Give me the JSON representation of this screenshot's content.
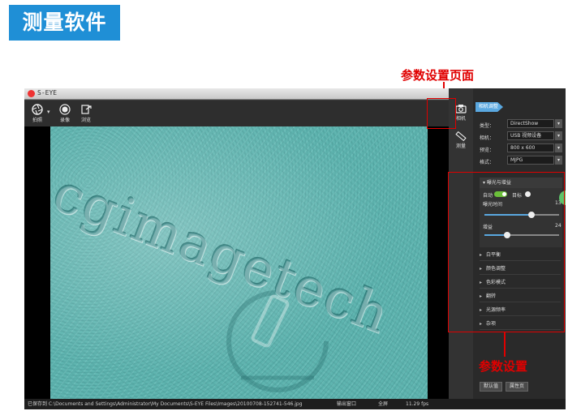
{
  "banner": {
    "title": "测量软件"
  },
  "callouts": {
    "page_label": "参数设置页面",
    "params_label": "参数设置"
  },
  "window": {
    "title": "S-EYE",
    "controls": [
      "▾",
      "–",
      "⧉",
      "✕"
    ]
  },
  "toolbar": {
    "buttons": [
      {
        "label": "拍照",
        "icon": "aperture-icon"
      },
      {
        "label": "录像",
        "icon": "record-icon"
      },
      {
        "label": "浏览",
        "icon": "browse-icon"
      }
    ]
  },
  "viewer": {
    "watermark": "cgimagetech"
  },
  "rail": {
    "buttons": [
      {
        "label": "相机",
        "icon": "camera-icon"
      },
      {
        "label": "测量",
        "icon": "ruler-icon"
      }
    ]
  },
  "panel": {
    "tab_label": "相机调整",
    "properties": [
      {
        "key": "类型：",
        "value": "DirectShow"
      },
      {
        "key": "相机：",
        "value": "USB 视频设备"
      },
      {
        "key": "预览：",
        "value": "800 x 600"
      },
      {
        "key": "格式：",
        "value": "MJPG"
      }
    ],
    "exposure": {
      "header": "曝光与增益",
      "auto_label": "自动",
      "target_label": "目标",
      "exposure_time_label": "曝光时间",
      "exposure_time_value": "13",
      "exposure_time_level": 0.63,
      "gain_label": "增益",
      "gain_value": "24",
      "gain_level": 0.3,
      "auto_on": true
    },
    "sections": [
      "白平衡",
      "颜色调整",
      "色彩模式",
      "翻转",
      "光源频率",
      "杂项"
    ],
    "defaults_button": "默认值",
    "properties_button": "属性页"
  },
  "statusbar": {
    "saved_path": "已保存到 C:\\Documents and Settings\\Administrator\\My Documents\\S-EYE Files\\Images\\20100708-152741-546.jpg",
    "output_window": "输出窗口",
    "fullscreen": "全屏",
    "fps": "11.29 fps"
  },
  "colors": {
    "accent": "#5aa8e0",
    "banner": "#1f8fd6",
    "callout": "#e00000",
    "toggle_on": "#6bbf3a"
  }
}
